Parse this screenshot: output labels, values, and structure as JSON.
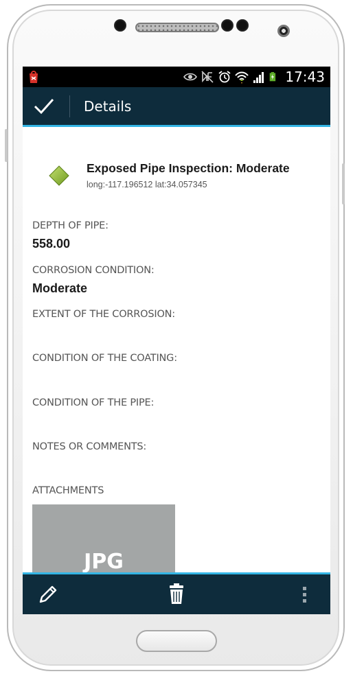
{
  "status_bar": {
    "time": "17:43",
    "icons": [
      "app-notification-icon",
      "eye-icon",
      "nfc-mute-icon",
      "alarm-icon",
      "wifi-icon",
      "signal-icon",
      "battery-charging-icon"
    ]
  },
  "action_bar": {
    "done_icon": "check-icon",
    "title": "Details"
  },
  "feature": {
    "icon": "diamond-point-symbol-icon",
    "title": "Exposed Pipe Inspection: Moderate",
    "coordinates": "long:-117.196512 lat:34.057345"
  },
  "fields": [
    {
      "label": "DEPTH OF PIPE:",
      "value": "558.00"
    },
    {
      "label": "CORROSION CONDITION:",
      "value": "Moderate"
    },
    {
      "label": "EXTENT OF THE CORROSION:",
      "value": ""
    },
    {
      "label": "CONDITION OF THE COATING:",
      "value": ""
    },
    {
      "label": "CONDITION OF THE PIPE:",
      "value": ""
    },
    {
      "label": "NOTES OR COMMENTS:",
      "value": ""
    }
  ],
  "attachments": {
    "label": "ATTACHMENTS",
    "items": [
      {
        "type_label": "JPG"
      }
    ]
  },
  "bottom_bar": {
    "icons": [
      "edit-pencil-icon",
      "trash-icon",
      "overflow-menu-icon"
    ]
  },
  "colors": {
    "action_bar": "#0e2c3c",
    "accent": "#33b5e5",
    "feature_symbol": "#8fbf2f"
  }
}
